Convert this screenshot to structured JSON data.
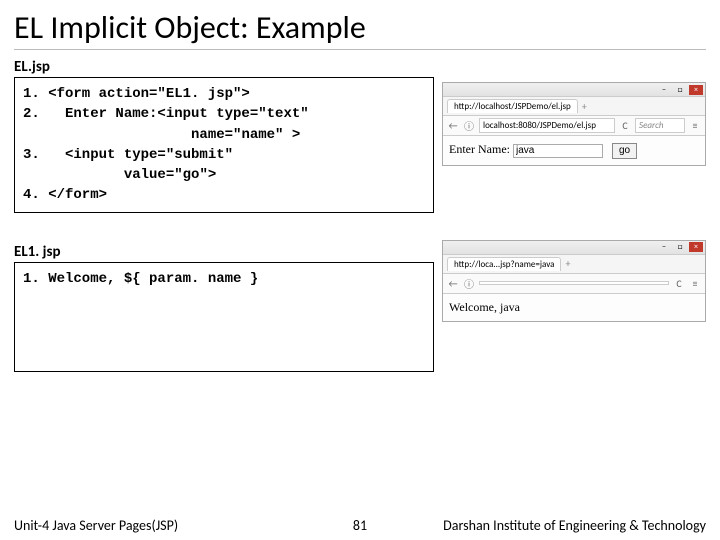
{
  "title": "EL Implicit Object: Example",
  "file1": {
    "label": "EL.jsp",
    "code": "1. <form action=\"EL1. jsp\">\n2.   Enter Name:<input type=\"text\"\n                    name=\"name\" >\n3.   <input type=\"submit\"\n            value=\"go\">\n4. </form>"
  },
  "file2": {
    "label": "EL1. jsp",
    "code": "1. Welcome, ${ param. name }"
  },
  "browser1": {
    "tab_text": "http://localhost/JSPDemo/el.jsp",
    "url": "localhost:8080/JSPDemo/el.jsp",
    "search_placeholder": "Search",
    "body_label": "Enter Name:",
    "input_value": "java",
    "button_label": "go"
  },
  "browser2": {
    "tab_text": "http://loca...jsp?name=java",
    "url": "",
    "body_text": "Welcome, java"
  },
  "footer": {
    "unit": "Unit-4 Java Server Pages(JSP)",
    "page": "81",
    "org": "Darshan Institute of Engineering & Technology"
  }
}
